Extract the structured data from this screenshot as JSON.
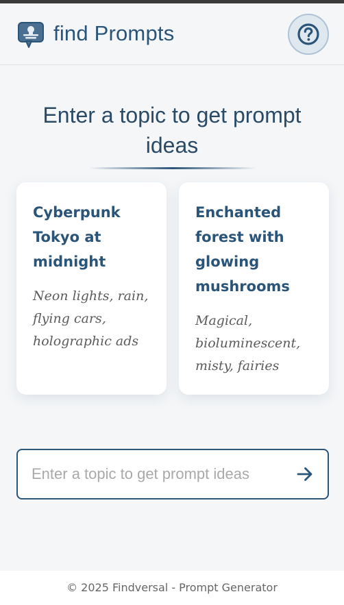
{
  "header": {
    "title": "find Prompts",
    "logo_icon": "chat-lightbulb-icon",
    "help_icon": "question-circle-icon"
  },
  "main": {
    "heading": "Enter a topic to get prompt ideas",
    "cards": [
      {
        "title": "Cyberpunk Tokyo at midnight",
        "description": "Neon lights, rain, flying cars, holographic ads"
      },
      {
        "title": "Enchanted forest with glowing mushrooms",
        "description": "Magical, bioluminescent, misty, fairies"
      }
    ]
  },
  "search": {
    "placeholder": "Enter a topic to get prompt ideas",
    "value": "",
    "submit_icon": "arrow-right-icon"
  },
  "footer": {
    "text": "© 2025 Findversal - Prompt Generator"
  },
  "colors": {
    "accent": "#2a5478",
    "background": "#f4f6f8",
    "card": "#ffffff",
    "muted_text": "#5b5b5b"
  }
}
